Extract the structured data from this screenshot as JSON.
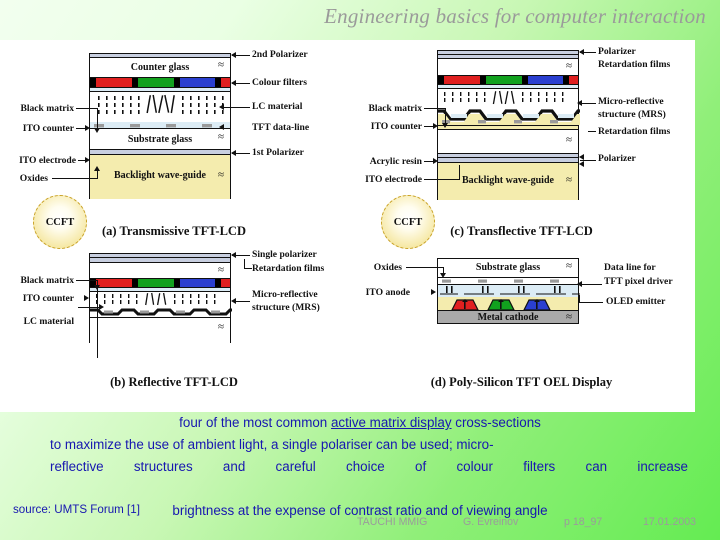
{
  "slide": {
    "title": "Engineering basics for computer interaction",
    "background_gradient": [
      "#f2ffef",
      "#64ec52"
    ],
    "title_color": "#9a9a9a"
  },
  "figure": {
    "panels": [
      {
        "id": "a",
        "caption": "(a) Transmissive TFT-LCD",
        "left_labels": [
          "Black matrix",
          "ITO counter",
          "ITO electrode",
          "Oxides"
        ],
        "right_labels": [
          "2nd Polarizer",
          "Colour filters",
          "LC material",
          "TFT data-line",
          "1st Polarizer"
        ],
        "inner_labels": [
          "Counter glass",
          "Substrate glass",
          "Backlight wave-guide"
        ],
        "lamp": "CCFT"
      },
      {
        "id": "c",
        "caption": "(c) Transflective TFT-LCD",
        "left_labels": [
          "Black matrix",
          "ITO counter",
          "Acrylic resin",
          "ITO electrode"
        ],
        "right_labels": [
          "Polarizer",
          "Retardation films",
          "Micro-reflective",
          "structure (MRS)",
          "Retardation films",
          "Polarizer"
        ],
        "inner_labels": [
          "Backlight wave-guide"
        ],
        "lamp": "CCFT"
      },
      {
        "id": "b",
        "caption": "(b) Reflective TFT-LCD",
        "left_labels": [
          "Black matrix",
          "ITO counter",
          "LC material"
        ],
        "right_labels": [
          "Single polarizer",
          "Retardation films",
          "Micro-reflective",
          "structure (MRS)"
        ],
        "inner_labels": [],
        "lamp": ""
      },
      {
        "id": "d",
        "caption": "(d) Poly-Silicon TFT OEL Display",
        "left_labels": [
          "Oxides",
          "ITO anode"
        ],
        "right_labels": [
          "Data line for",
          "TFT pixel driver",
          "OLED emitter"
        ],
        "inner_labels": [
          "Substrate glass",
          "Metal cathode"
        ],
        "lamp": ""
      }
    ],
    "colors": {
      "red_filter": "#e02020",
      "green_filter": "#11a11e",
      "blue_filter": "#2a3fd0",
      "glass": "#ffffff",
      "backlight": "#f4ecae",
      "polarizer": "#c8cfe0",
      "ito": "#d8e9f2",
      "metal": "#aaaaaa",
      "black_matrix": "#000000"
    }
  },
  "caption": {
    "line1_pre": "four of the most common ",
    "line1_underlined": "active matrix display",
    "line1_post": " cross-sections",
    "line2": "to maximize the use of ambient light, a single polariser can be used; micro-",
    "line3": "reflective structures and careful choice of colour filters can increase",
    "line4": "brightness at the expense of contrast ratio and of viewing angle",
    "color": "#1717b0"
  },
  "source": "source: UMTS Forum [1]",
  "footer": {
    "org": "TAUCHI MMIG",
    "author": "G. Evreinov",
    "page": "p 18_97",
    "date": "17.01.2003",
    "color": "#9b9b9b"
  }
}
